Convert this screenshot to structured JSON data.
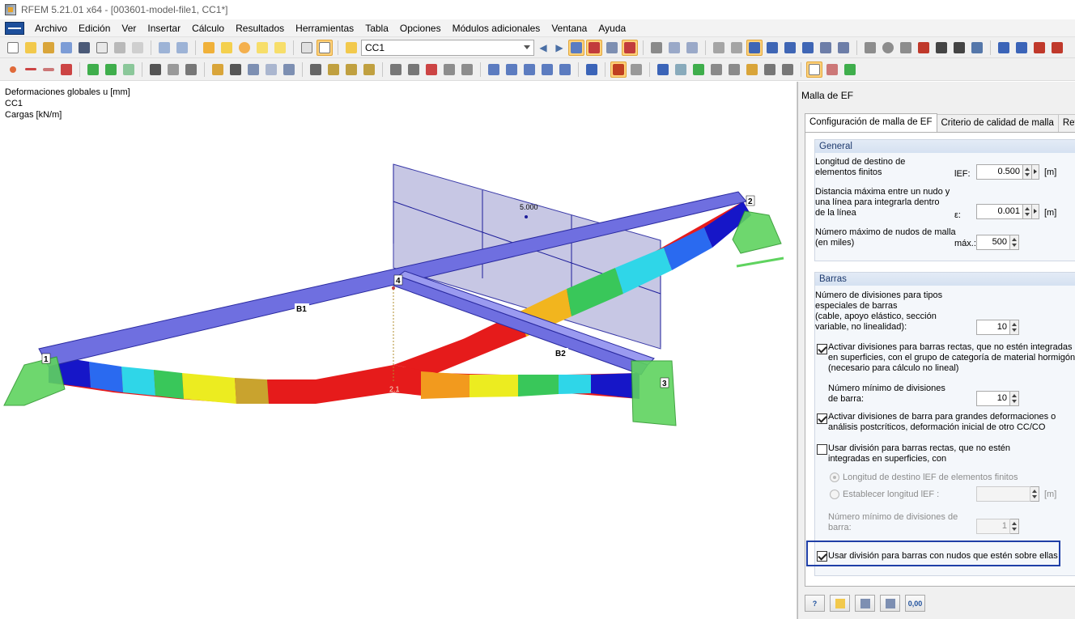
{
  "window": {
    "title": "RFEM 5.21.01 x64 - [003601-model-file1, CC1*]"
  },
  "menu": [
    "Archivo",
    "Edición",
    "Ver",
    "Insertar",
    "Cálculo",
    "Resultados",
    "Herramientas",
    "Tabla",
    "Opciones",
    "Módulos adicionales",
    "Ventana",
    "Ayuda"
  ],
  "toolbar": {
    "load_case": "CC1"
  },
  "viewport": {
    "info_line1": "Deformaciones globales u [mm]",
    "info_line2": "CC1",
    "info_line3": "Cargas [kN/m]",
    "load_value": "5.000",
    "member_labels": [
      "B1",
      "B2"
    ],
    "node_labels": [
      "1",
      "2",
      "3",
      "4"
    ],
    "value_label": "2.1"
  },
  "panel": {
    "title": "Malla de EF",
    "tabs": [
      "Configuración de malla de EF",
      "Criterio de calidad de malla",
      "Refinam"
    ],
    "general": {
      "header": "General",
      "target_length_label_1": "Longitud de destino de",
      "target_length_label_2": "elementos finitos",
      "target_length_sym": "lEF:",
      "target_length_value": "0.500",
      "target_length_unit": "[m]",
      "max_dist_label_1": "Distancia máxima entre un nudo y",
      "max_dist_label_2": "una línea para integrarla dentro",
      "max_dist_label_3": "de la línea",
      "max_dist_sym": "ε:",
      "max_dist_value": "0.001",
      "max_dist_unit": "[m]",
      "max_nodes_label_1": "Número máximo de nudos de malla",
      "max_nodes_label_2": "(en miles)",
      "max_nodes_sym": "máx.:",
      "max_nodes_value": "500"
    },
    "members": {
      "header": "Barras",
      "special_label_1": "Número de divisiones para tipos",
      "special_label_2": "especiales de barras",
      "special_label_3": "(cable, apoyo elástico, sección",
      "special_label_4": "variable, no linealidad):",
      "special_value": "10",
      "activate_straight_1": "Activar divisiones para barras rectas, que no estén integradas",
      "activate_straight_2": "en superficies, con el grupo de categoría de material hormigón",
      "activate_straight_3": "(necesario para cálculo no lineal)",
      "min_div_label_1": "Número mínimo de divisiones",
      "min_div_label_2": "de barra:",
      "min_div_value": "10",
      "activate_large_1": "Activar divisiones de barra para grandes deformaciones o",
      "activate_large_2": "análisis postcríticos, deformación inicial de otro CC/CO",
      "use_div_straight_1": "Usar división para barras rectas, que no estén",
      "use_div_straight_2": "integradas en superficies, con",
      "radio_target": "Longitud de destino lEF de elementos finitos",
      "radio_set": "Establecer longitud lEF :",
      "set_unit": "[m]",
      "min_div2_label_1": "Número mínimo de divisiones de",
      "min_div2_label_2": "barra:",
      "min_div2_value": "1",
      "use_div_nodes": "Usar división para barras con nudos que estén sobre ellas"
    },
    "footer_value_button": "0,00"
  },
  "colors": {
    "accent": "#1f3fa7",
    "member": "#6f6fe0",
    "support": "#5fd35f"
  }
}
